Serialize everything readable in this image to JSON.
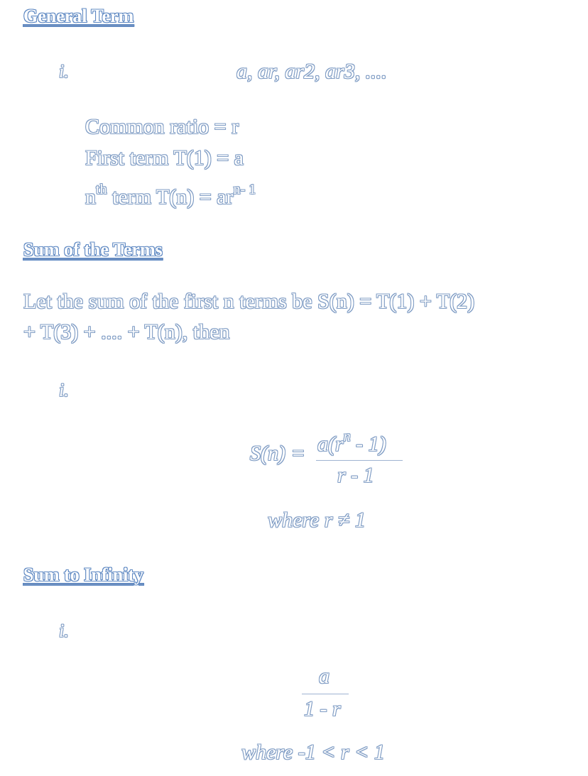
{
  "general_term": {
    "heading": "General Term",
    "numeral": "i.",
    "sequence": "a, ar, ar2, ar3, ....",
    "common_ratio": "Common ratio = r",
    "first_term": "First term T(1) = a",
    "nth_prefix": "n",
    "nth_sup": "th",
    "nth_mid": " term T(n) = ar",
    "nth_exp": "n- 1"
  },
  "sum_of_terms": {
    "heading": "Sum of the Terms",
    "intro_line1": "Let the sum of the first n terms be S(n) = T(1) + T(2)",
    "intro_line2": "+ T(3) + .... + T(n), then",
    "numeral": "i.",
    "formula_lhs": "S(n) =",
    "numerator_a": "a(r",
    "numerator_exp": "n",
    "numerator_b": " - 1)",
    "denominator": "r - 1",
    "condition": "where r ≠ 1"
  },
  "sum_to_infinity": {
    "heading": "Sum to Infinity",
    "numeral": "i.",
    "numerator": "a",
    "denominator": "1 - r",
    "condition": "where -1 < r < 1"
  }
}
